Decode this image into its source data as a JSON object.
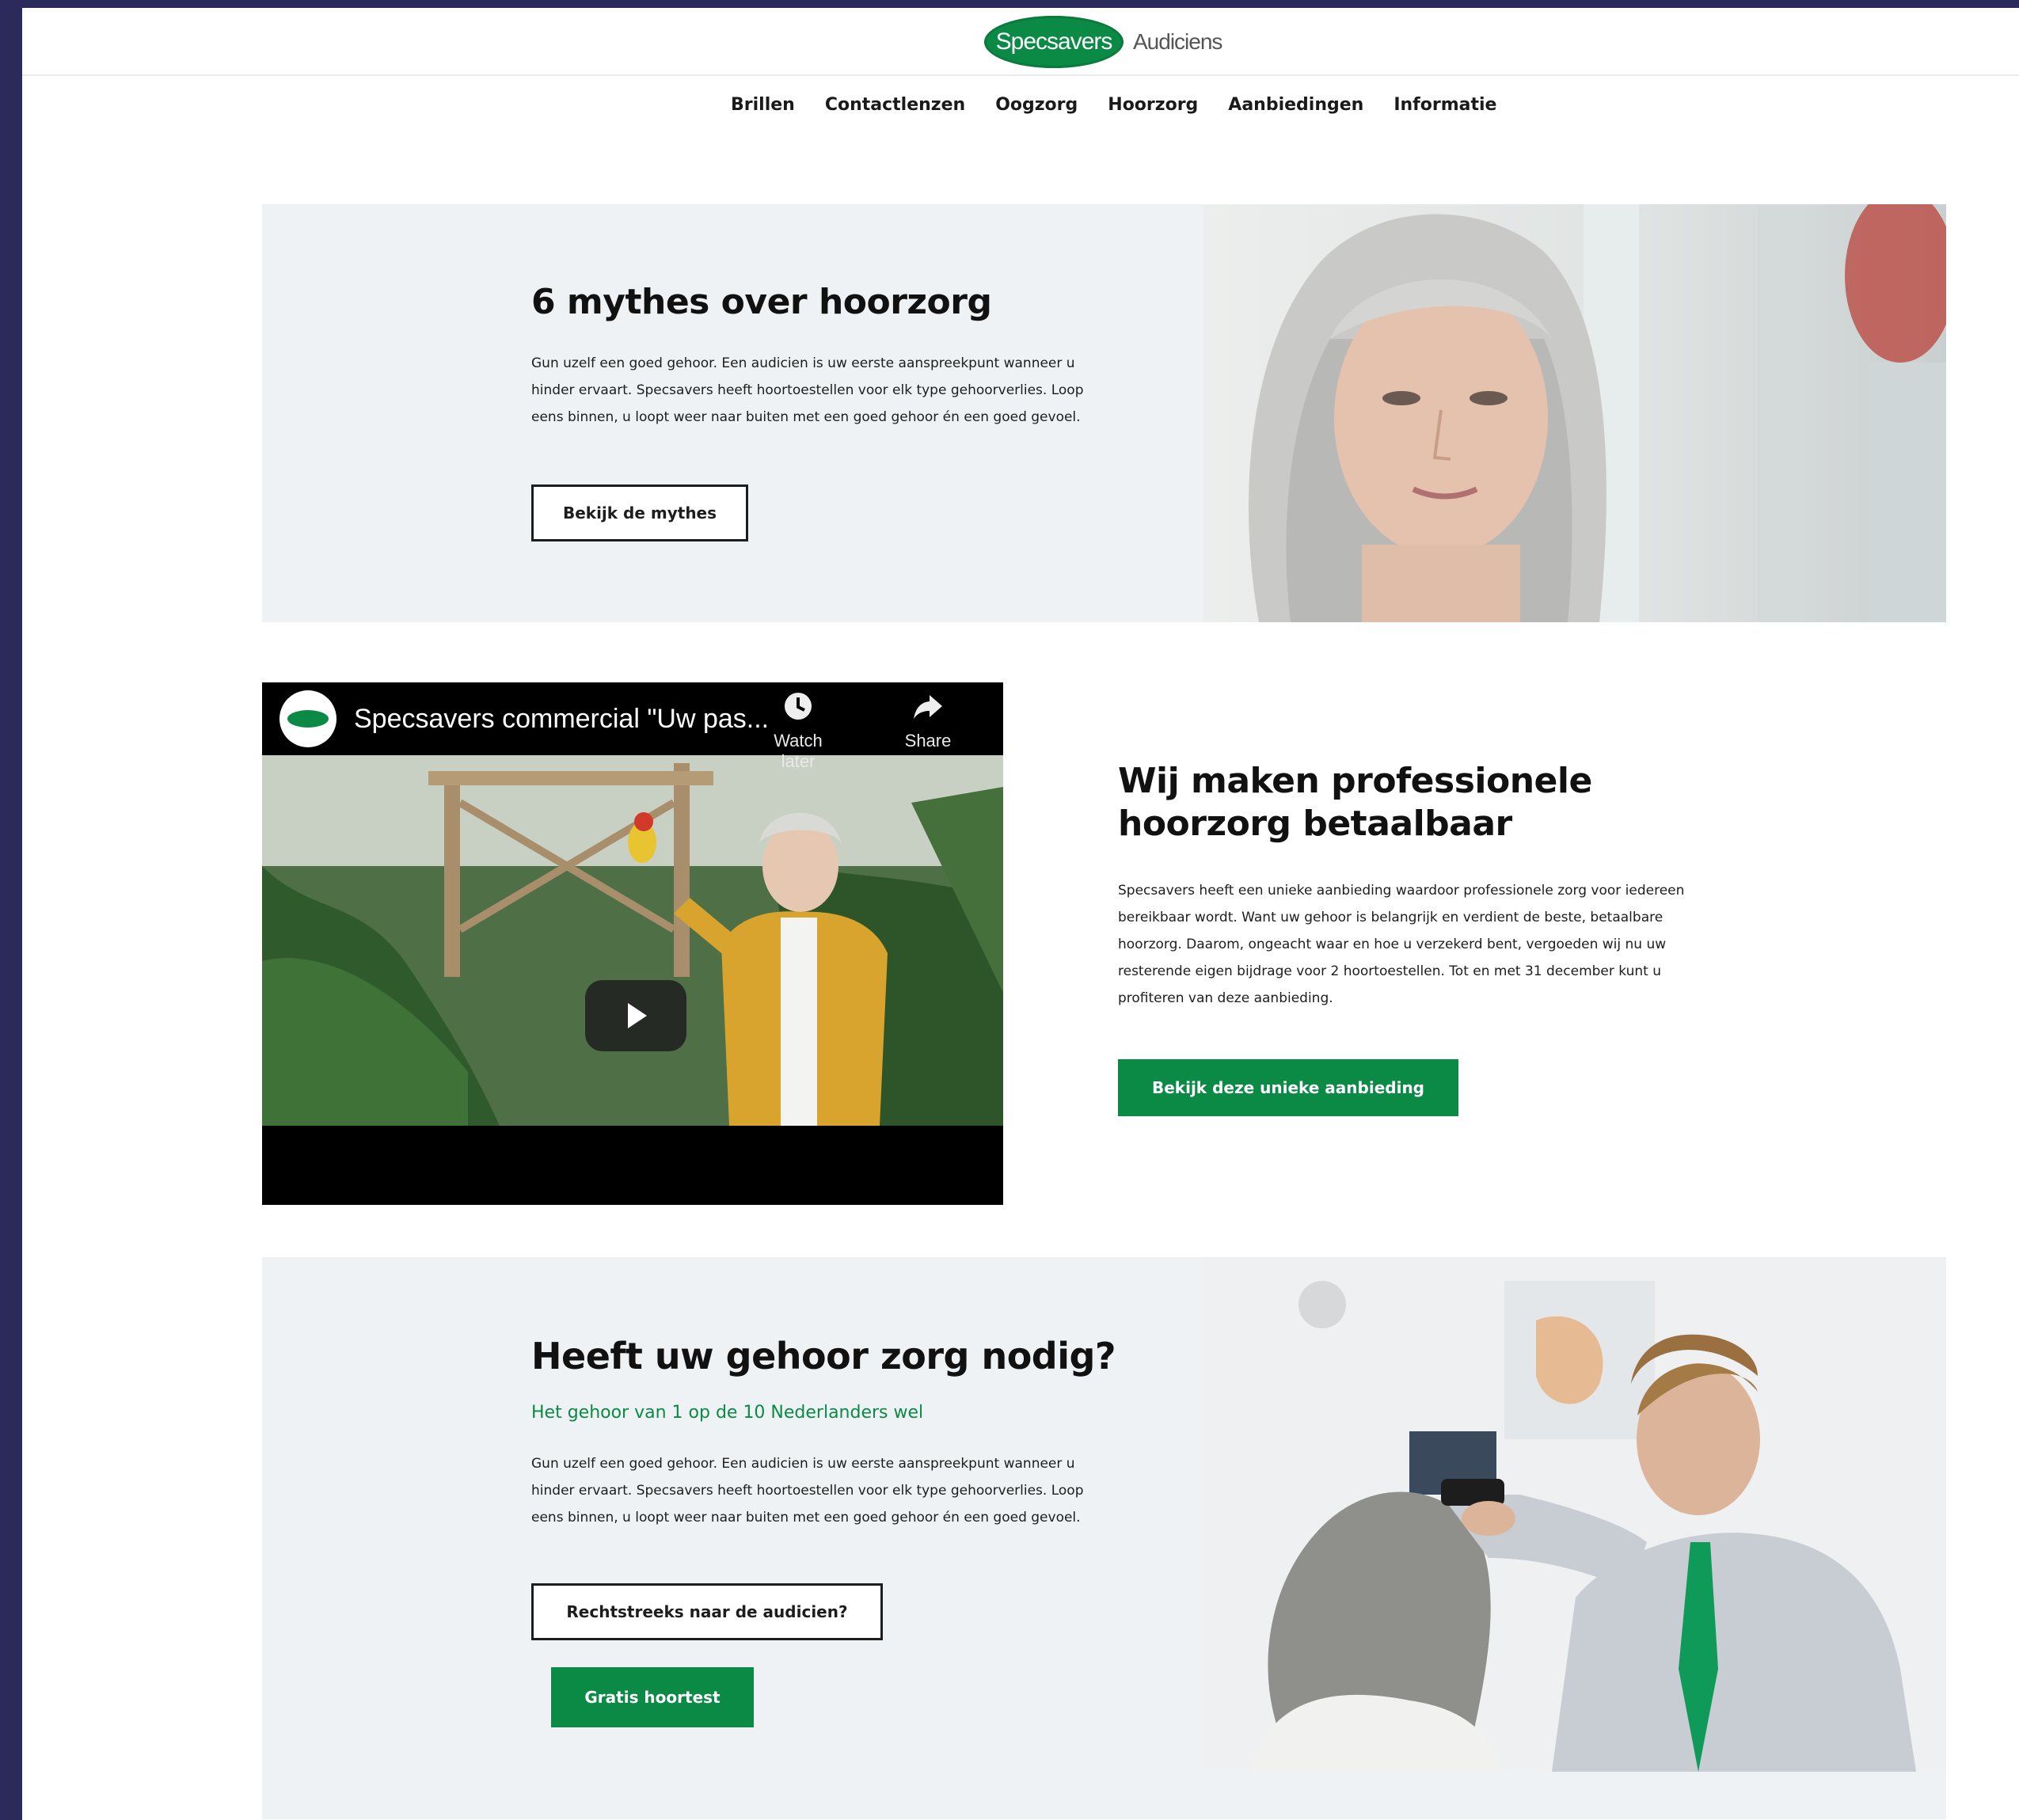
{
  "brand": {
    "logo_text": "Specsavers",
    "logo_suffix": "Audiciens",
    "green": "#0b8a45"
  },
  "nav": {
    "items": [
      "Brillen",
      "Contactlenzen",
      "Oogzorg",
      "Hoorzorg",
      "Aanbiedingen",
      "Informatie"
    ]
  },
  "section1": {
    "title": "6 mythes over hoorzorg",
    "body": "Gun uzelf een goed gehoor. Een audicien is uw eerste aanspreekpunt wanneer u hinder ervaart. Specsavers heeft hoortoestellen voor elk type gehoorverlies. Loop eens binnen, u loopt weer naar buiten met een goed gehoor én een goed gevoel.",
    "button": "Bekijk de mythes"
  },
  "video": {
    "title": "Specsavers commercial \"Uw pas...",
    "watch_later": "Watch later",
    "share": "Share",
    "watch_later_icon": "clock-icon",
    "share_icon": "share-arrow-icon",
    "play_icon": "play-icon"
  },
  "section2": {
    "title_line1": "Wij maken professionele",
    "title_line2": "hoorzorg betaalbaar",
    "body": "Specsavers heeft een unieke aanbieding waardoor professionele zorg voor iedereen bereikbaar wordt. Want uw gehoor is belangrijk en verdient de beste, betaalbare hoorzorg. Daarom, ongeacht waar en hoe u verzekerd bent, vergoeden wij nu uw resterende eigen bijdrage voor 2 hoortoestellen. Tot en met 31 december kunt u profiteren van deze aanbieding.",
    "button": "Bekijk deze unieke aanbieding"
  },
  "section3": {
    "title": "Heeft uw gehoor zorg nodig?",
    "subtitle": "Het gehoor van 1 op de 10 Nederlanders wel",
    "body": "Gun uzelf een goed gehoor. Een audicien is uw eerste aanspreekpunt wanneer u hinder ervaart. Specsavers heeft hoortoestellen voor elk type gehoorverlies. Loop eens binnen, u loopt weer naar buiten met een goed gehoor én een goed gevoel.",
    "button_outline": "Rechtstreeks naar de audicien?",
    "button_green": "Gratis hoortest"
  }
}
